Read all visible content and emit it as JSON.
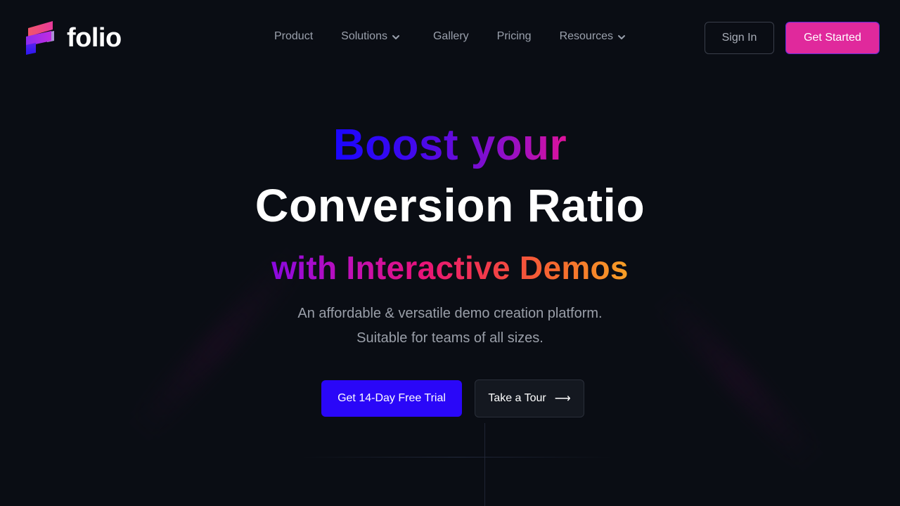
{
  "brand": {
    "name": "folio",
    "logo_icon": "folio-stacked-f-icon",
    "colors": {
      "logo_top": "#f0556a",
      "logo_mid": "#b025e8",
      "logo_bottom": "#3a1bf2"
    }
  },
  "nav": {
    "items": [
      {
        "label": "Product",
        "has_dropdown": false
      },
      {
        "label": "Solutions",
        "has_dropdown": true,
        "icon": "chevron-down-icon"
      },
      {
        "label": "Gallery",
        "has_dropdown": false
      },
      {
        "label": "Pricing",
        "has_dropdown": false
      },
      {
        "label": "Resources",
        "has_dropdown": true,
        "icon": "chevron-down-icon"
      }
    ]
  },
  "header_actions": {
    "sign_in_label": "Sign In",
    "get_started_label": "Get Started",
    "get_started_color": "#e0299c"
  },
  "hero": {
    "line1": "Boost your",
    "line2": "Conversion Ratio",
    "line3": "with Interactive Demos",
    "subtitle_line1": "An affordable & versatile demo creation platform.",
    "subtitle_line2": "Suitable for teams of all sizes.",
    "primary_cta_label": "Get 14-Day Free Trial",
    "primary_cta_color": "#2a07f8",
    "secondary_cta_label": "Take a Tour",
    "secondary_cta_icon": "arrow-right-icon",
    "secondary_cta_arrow": "⟶"
  },
  "theme": {
    "background": "#0a0d14",
    "muted_text": "#9aa0ac"
  }
}
